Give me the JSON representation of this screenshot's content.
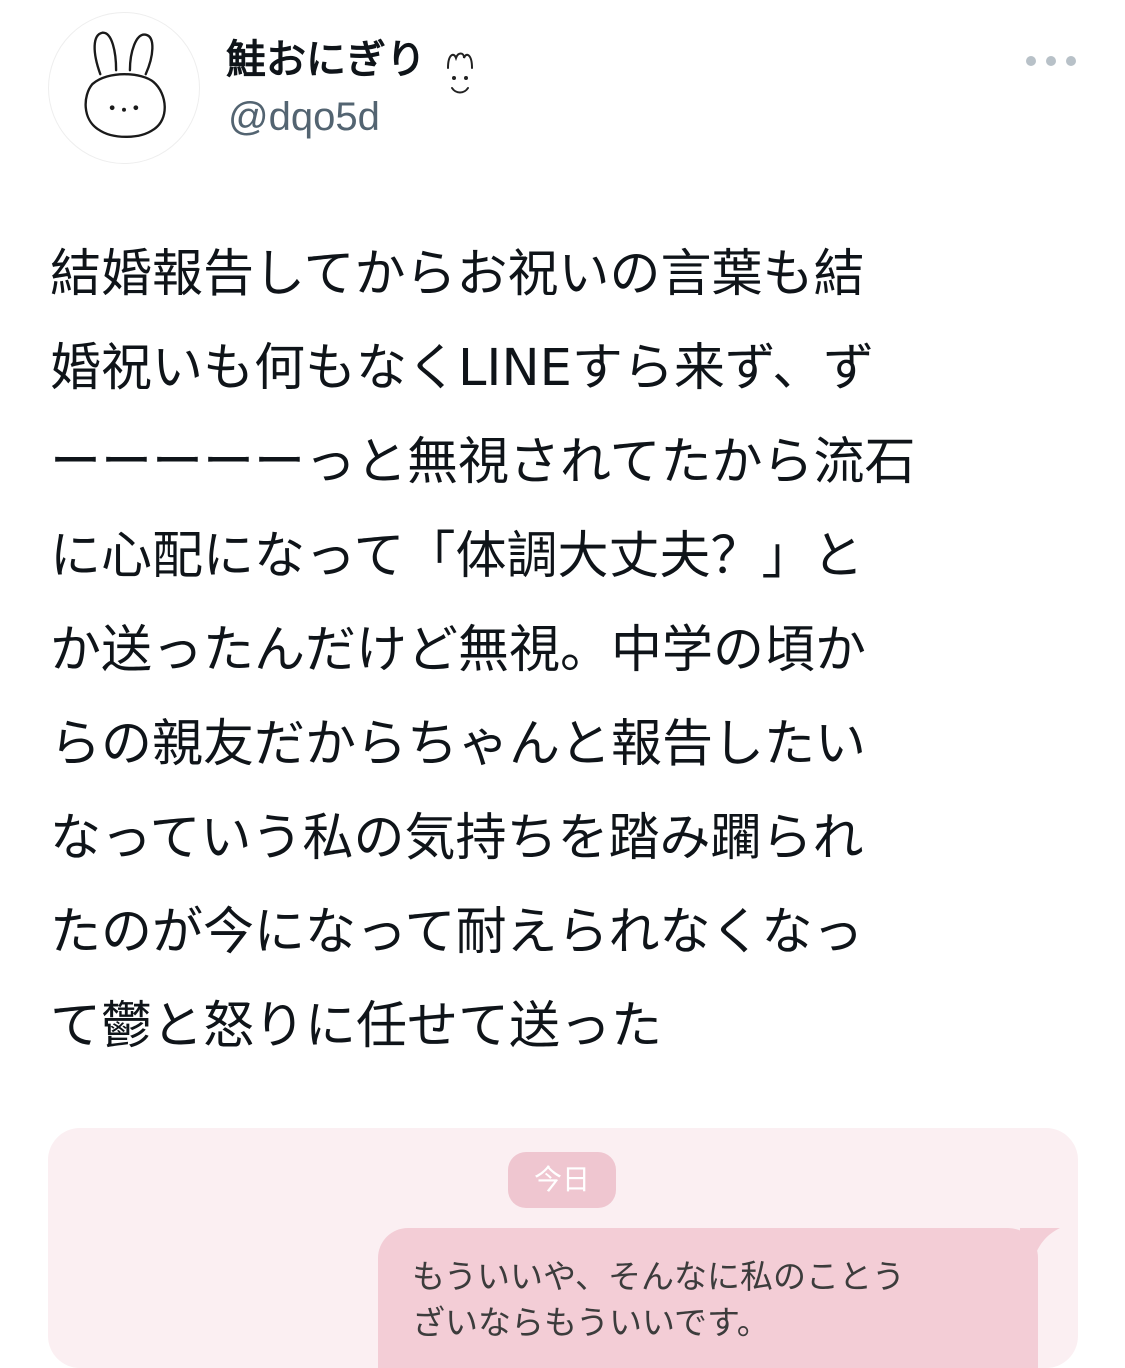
{
  "tweet": {
    "author": {
      "display_name": "鮭おにぎり",
      "handle": "@dqo5d",
      "avatar_icon": "bunny-icon"
    },
    "more_icon": "more-dots-icon",
    "text": "結婚報告してからお祝いの言葉も結\n婚祝いも何もなくLINEすら来ず、ず\nーーーーーっと無視されてたから流石\nに心配になって「体調大丈夫？」と\nか送ったんだけど無視。中学の頃か\nらの親友だからちゃんと報告したい\nなっていう私の気持ちを踏み躙られ\nたのが今になって耐えられなくなっ\nて鬱と怒りに任せて送った"
  },
  "media": {
    "date_label": "今日",
    "message": "もういいや、そんなに私のことう\nざいならもういいです。"
  },
  "colors": {
    "handle": "#536471",
    "media_bg": "#fbeff2",
    "bubble_bg": "#f3cdd6",
    "date_pill_bg": "#efc6d0"
  }
}
